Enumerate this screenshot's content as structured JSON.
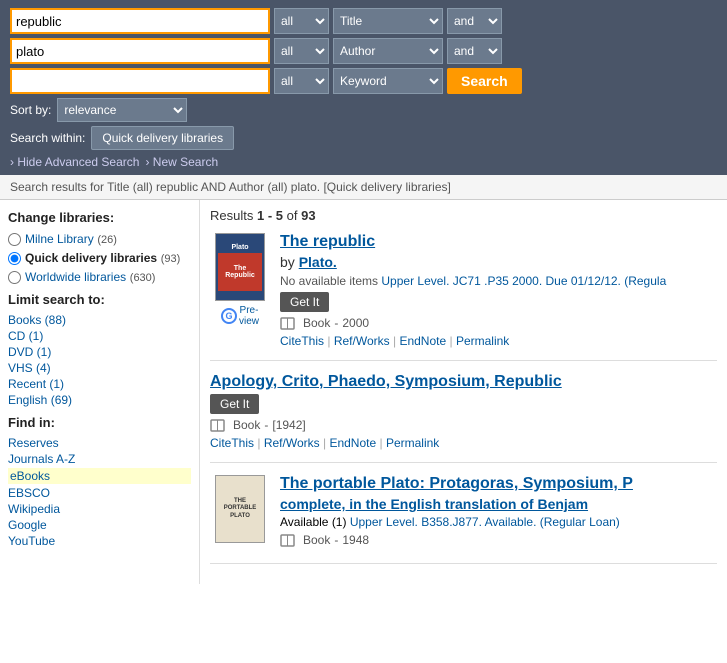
{
  "search": {
    "rows": [
      {
        "value": "republic",
        "scope": "all",
        "field": "Title",
        "connector": "and"
      },
      {
        "value": "plato",
        "scope": "all",
        "field": "Author",
        "connector": "and"
      },
      {
        "value": "",
        "scope": "all",
        "field": "Keyword",
        "connector": ""
      }
    ],
    "sort_by_label": "Sort by:",
    "sort_value": "relevance",
    "within_label": "Search within:",
    "within_value": "Quick delivery libraries",
    "hide_advanced_label": "Hide Advanced Search",
    "new_search_label": "New Search",
    "search_button_label": "Search"
  },
  "results_info_bar": "Search results for Title (all) republic AND Author (all) plato. [Quick delivery libraries]",
  "results": {
    "count_text": "Results",
    "range": "1 - 5",
    "of": "of",
    "total": "93",
    "items": [
      {
        "title": "The republic",
        "author_prefix": "by",
        "author": "Plato.",
        "availability": "No available items",
        "availability_detail": "Upper Level. JC71 .P35 2000. Due 01/12/12. (Regula",
        "format": "Book",
        "year": "2000",
        "has_cover": true,
        "cover_title": "Plato",
        "cover_subtitle": "The Republic",
        "has_google_preview": true,
        "actions": [
          "CiteThis",
          "Ref/Works",
          "EndNote",
          "Permalink"
        ]
      },
      {
        "title": "Apology, Crito, Phaedo, Symposium, Republic",
        "author_prefix": "",
        "author": "",
        "availability": "",
        "availability_detail": "",
        "format": "Book",
        "year": "[1942]",
        "has_cover": false,
        "has_google_preview": false,
        "actions": [
          "CiteThis",
          "Ref/Works",
          "EndNote",
          "Permalink"
        ]
      },
      {
        "title": "The portable Plato: Protagoras, Symposium, P",
        "title_cont": "complete, in the English translation of Benjam",
        "author_prefix": "",
        "author": "",
        "availability": "Available (1)",
        "availability_detail": "Upper Level. B358.J877. Available. (Regular Loan)",
        "format": "Book",
        "year": "1948",
        "has_cover": true,
        "cover_title": "THE\nPORTABLE\nPLATO",
        "cover_subtitle": "",
        "has_google_preview": false,
        "actions": []
      }
    ]
  },
  "sidebar": {
    "change_libraries_title": "Change libraries:",
    "libraries": [
      {
        "name": "Milne Library",
        "count": "(26)",
        "selected": false
      },
      {
        "name": "Quick delivery libraries",
        "count": "(93)",
        "selected": true
      },
      {
        "name": "Worldwide libraries",
        "count": "(630)",
        "selected": false
      }
    ],
    "limit_title": "Limit search to:",
    "limits": [
      {
        "label": "Books (88)"
      },
      {
        "label": "CD (1)"
      },
      {
        "label": "DVD (1)"
      },
      {
        "label": "VHS (4)"
      },
      {
        "label": "Recent (1)"
      },
      {
        "label": "English (69)"
      }
    ],
    "find_in_title": "Find in:",
    "find_in": [
      {
        "label": "Reserves",
        "highlight": false
      },
      {
        "label": "Journals A-Z",
        "highlight": false
      },
      {
        "label": "eBooks",
        "highlight": true
      },
      {
        "label": "EBSCO",
        "highlight": false
      },
      {
        "label": "Wikipedia",
        "highlight": false
      },
      {
        "label": "Google",
        "highlight": false
      },
      {
        "label": "YouTube",
        "highlight": false
      }
    ]
  }
}
